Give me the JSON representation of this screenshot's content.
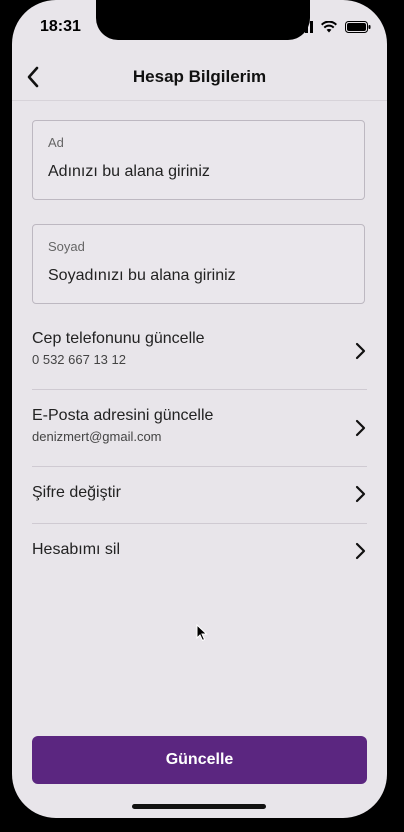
{
  "status_bar": {
    "time": "18:31"
  },
  "nav": {
    "title": "Hesap Bilgilerim"
  },
  "form": {
    "first_name": {
      "label": "Ad",
      "placeholder": "Adınızı bu alana giriniz"
    },
    "last_name": {
      "label": "Soyad",
      "placeholder": "Soyadınızı bu alana giriniz"
    }
  },
  "menu": [
    {
      "title": "Cep telefonunu güncelle",
      "subtitle": "0 532 667 13 12"
    },
    {
      "title": "E-Posta adresini güncelle",
      "subtitle": "denizmert@gmail.com"
    },
    {
      "title": "Şifre değiştir"
    },
    {
      "title": "Hesabımı sil"
    }
  ],
  "footer": {
    "button_label": "Güncelle"
  },
  "colors": {
    "primary": "#5b2680",
    "background": "#e8e5ea"
  }
}
